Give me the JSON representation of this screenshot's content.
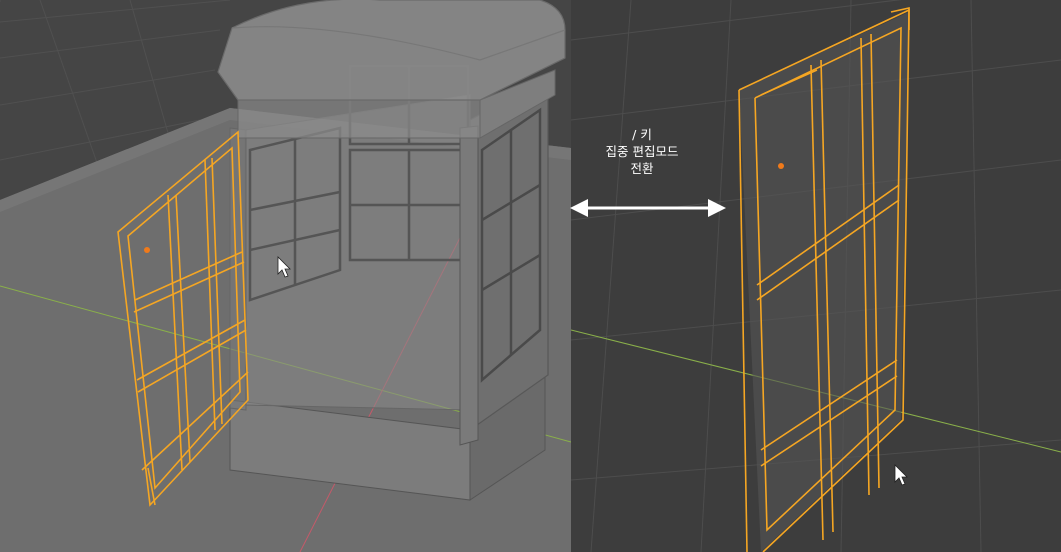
{
  "annotation": {
    "key_line": "/ 키",
    "action_line": "집중 편집모드",
    "result_line": "전환"
  },
  "icons": {
    "mouse_cursor": "mouse-cursor-icon",
    "double_arrow": "double-headed-arrow-icon",
    "object_origin": "origin-dot-icon"
  },
  "colors": {
    "selection_outline": "#f5a623",
    "left_viewport_background": "#454545",
    "right_viewport_background": "#3d3d3d",
    "grid_line": "#4d4d4d",
    "x_axis": "#c45a6a",
    "y_axis": "#8ab04a",
    "annotation_text": "#ffffff"
  },
  "views": {
    "left": "scene-view-with-selected-window",
    "right": "local-view-isolated-window"
  }
}
